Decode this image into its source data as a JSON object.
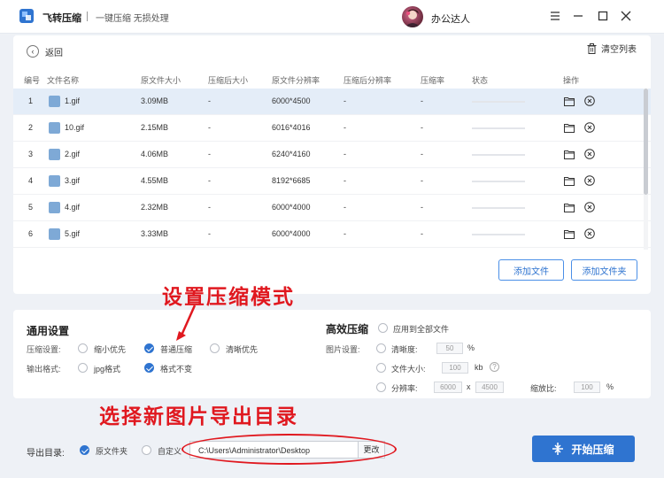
{
  "app": {
    "name": "飞转压缩",
    "slogan": "一键压缩 无损处理",
    "user_name": "办公达人"
  },
  "toolbar": {
    "back_label": "返回",
    "clear_label": "清空列表"
  },
  "table": {
    "headers": {
      "no": "编号",
      "name": "文件名称",
      "orig_size": "原文件大小",
      "comp_size": "压缩后大小",
      "orig_res": "原文件分辨率",
      "comp_res": "压缩后分辨率",
      "rate": "压缩率",
      "status": "状态",
      "ops": "操作"
    },
    "rows": [
      {
        "no": "1",
        "name": "1.gif",
        "orig_size": "3.09MB",
        "comp_size": "-",
        "orig_res": "6000*4500",
        "comp_res": "-",
        "rate": "-"
      },
      {
        "no": "2",
        "name": "10.gif",
        "orig_size": "2.15MB",
        "comp_size": "-",
        "orig_res": "6016*4016",
        "comp_res": "-",
        "rate": "-"
      },
      {
        "no": "3",
        "name": "2.gif",
        "orig_size": "4.06MB",
        "comp_size": "-",
        "orig_res": "6240*4160",
        "comp_res": "-",
        "rate": "-"
      },
      {
        "no": "4",
        "name": "3.gif",
        "orig_size": "4.55MB",
        "comp_size": "-",
        "orig_res": "8192*6685",
        "comp_res": "-",
        "rate": "-"
      },
      {
        "no": "5",
        "name": "4.gif",
        "orig_size": "2.32MB",
        "comp_size": "-",
        "orig_res": "6000*4000",
        "comp_res": "-",
        "rate": "-"
      },
      {
        "no": "6",
        "name": "5.gif",
        "orig_size": "3.33MB",
        "comp_size": "-",
        "orig_res": "6000*4000",
        "comp_res": "-",
        "rate": "-"
      }
    ]
  },
  "buttons": {
    "add_file": "添加文件",
    "add_folder": "添加文件夹",
    "start": "开始压缩"
  },
  "annotations": {
    "mode": "设置压缩模式",
    "export": "选择新图片导出目录",
    "color": "#e0181f"
  },
  "general": {
    "title": "通用设置",
    "compress_label": "压缩设置:",
    "compress_options": [
      "缩小优先",
      "普通压缩",
      "清晰优先"
    ],
    "compress_selected": "普通压缩",
    "format_label": "输出格式:",
    "format_options": [
      "jpg格式",
      "格式不变"
    ],
    "format_selected": "格式不变"
  },
  "advanced": {
    "title": "高效压缩",
    "apply_all": "应用到全部文件",
    "image_label": "图片设置:",
    "clarity_label": "清晰度:",
    "clarity_value": "50",
    "clarity_unit": "%",
    "size_label": "文件大小:",
    "size_value": "100",
    "size_unit": "kb",
    "help_glyph": "?",
    "res_label": "分辨率:",
    "res_w": "6000",
    "res_x": "x",
    "res_h": "4500",
    "scale_label": "缩放比:",
    "scale_value": "100",
    "scale_unit": "%"
  },
  "export": {
    "label": "导出目录:",
    "opt_source": "原文件夹",
    "opt_custom": "自定义",
    "selected": "原文件夹",
    "path": "C:\\Users\\Administrator\\Desktop",
    "change_label": "更改"
  },
  "colors": {
    "accent": "#2f74d0",
    "selected_row": "#e4edf8",
    "background": "#eef1f6"
  }
}
